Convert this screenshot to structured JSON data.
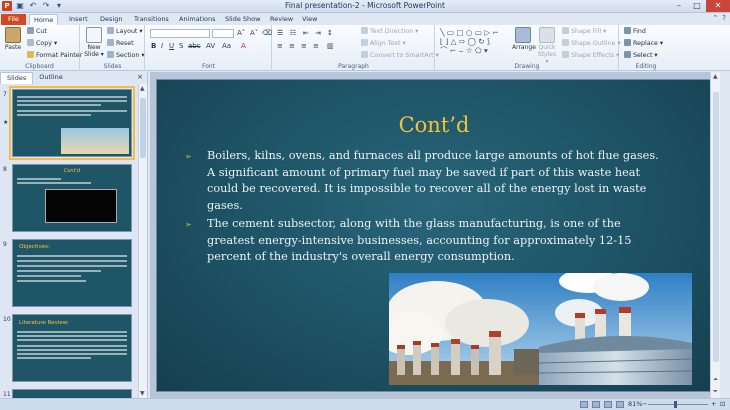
{
  "window": {
    "title": "Final presentation-2 - Microsoft PowerPoint",
    "app_badge": "P",
    "qat": [
      "save-icon",
      "undo-icon",
      "redo-icon",
      "customize-icon"
    ],
    "controls": [
      "–",
      "□",
      "✕"
    ]
  },
  "tabs": [
    {
      "label": "File"
    },
    {
      "label": "Home"
    },
    {
      "label": "Insert"
    },
    {
      "label": "Design"
    },
    {
      "label": "Transitions"
    },
    {
      "label": "Animations"
    },
    {
      "label": "Slide Show"
    },
    {
      "label": "Review"
    },
    {
      "label": "View"
    }
  ],
  "ribbon": {
    "clipboard": {
      "paste": "Paste",
      "cut": "Cut",
      "copy": "Copy ▾",
      "format_painter": "Format Painter",
      "label": "Clipboard"
    },
    "slides": {
      "new_slide": "New Slide ▾",
      "layout": "Layout ▾",
      "reset": "Reset",
      "section": "Section ▾",
      "label": "Slides"
    },
    "font": {
      "label": "Font"
    },
    "paragraph": {
      "text_direction": "Text Direction ▾",
      "align_text": "Align Text ▾",
      "convert": "Convert to SmartArt ▾",
      "label": "Paragraph"
    },
    "drawing": {
      "arrange": "Arrange",
      "quick_styles": "Quick Styles ▾",
      "shape_fill": "Shape Fill ▾",
      "shape_outline": "Shape Outline ▾",
      "shape_effects": "Shape Effects ▾",
      "label": "Drawing"
    },
    "editing": {
      "find": "Find",
      "replace": "Replace ▾",
      "select": "Select ▾",
      "label": "Editing"
    }
  },
  "panel": {
    "tabs": [
      "Slides",
      "Outline"
    ],
    "close": "×",
    "thumbs": [
      {
        "num": "7",
        "title": ""
      },
      {
        "num": "8",
        "title": "Cont'd"
      },
      {
        "num": "9",
        "title": "Objectives:"
      },
      {
        "num": "10",
        "title": "Literature Review:"
      },
      {
        "num": "11",
        "title": ""
      }
    ]
  },
  "slide": {
    "title": "Cont’d",
    "bullets": [
      "Boilers, kilns, ovens, and furnaces all produce large amounts of hot flue gases. A significant amount of primary fuel may be saved if part of this waste heat could be recovered. It is impossible to recover all of the energy lost in waste gases.",
      "The cement subsector, along with the glass manufacturing, is one of the greatest energy-intensive businesses, accounting for approximately 12-15 percent of the industry's overall energy consumption."
    ],
    "bullet_mark": "➢"
  },
  "status": {
    "zoom": "81%",
    "zoom_out": "−",
    "zoom_in": "+"
  },
  "colors": {
    "accent": "#d24a24",
    "slide_bg": "#1d5264",
    "title": "#f3c33c"
  }
}
